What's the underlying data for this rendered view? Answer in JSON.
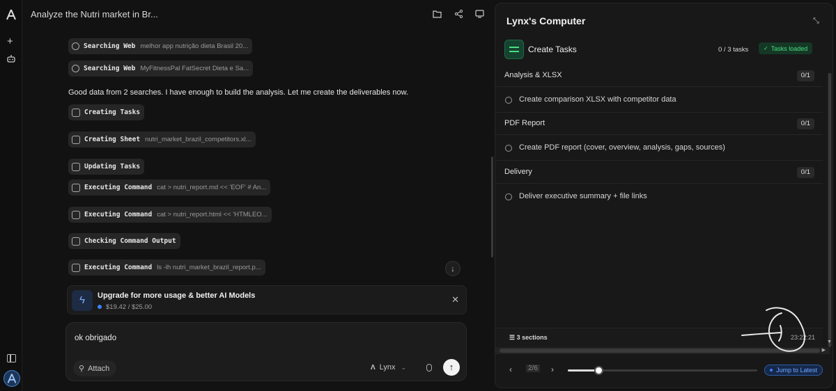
{
  "app": {
    "title": "Analyze the Nutri market in Br..."
  },
  "rail": {
    "icons": [
      "app-logo-icon",
      "plus-icon",
      "bot-icon",
      "sidebar-toggle-icon",
      "avatar"
    ]
  },
  "topbar": {
    "icons": [
      "folder-icon",
      "share-icon",
      "monitor-icon"
    ]
  },
  "chat": {
    "cut_text": "                 ",
    "steps": [
      {
        "icon": "search-icon",
        "action": "Searching Web",
        "detail": "melhor app nutrição dieta Brasil 20..."
      },
      {
        "icon": "search-icon",
        "action": "Searching Web",
        "detail": "MyFitnessPal FatSecret Dieta e Sa..."
      },
      {
        "icon": "list-icon",
        "action": "Creating Tasks",
        "detail": ""
      },
      {
        "icon": "table-icon",
        "action": "Creating Sheet",
        "detail": "nutri_market_brazil_competitors.xl..."
      },
      {
        "icon": "list-icon",
        "action": "Updating Tasks",
        "detail": ""
      },
      {
        "icon": "terminal-icon",
        "action": "Executing Command",
        "detail": "cat > nutri_report.md << 'EOF' # An..."
      },
      {
        "icon": "terminal-icon",
        "action": "Executing Command",
        "detail": "cat > nutri_report.html << 'HTMLEO..."
      },
      {
        "icon": "terminal-icon",
        "action": "Checking Command Output",
        "detail": ""
      },
      {
        "icon": "terminal-icon",
        "action": "Executing Command",
        "detail": "ls -lh nutri_market_brazil_report.p..."
      }
    ],
    "message": "Good data from 2 searches. I have enough to build the analysis. Let me create the deliverables now."
  },
  "upgrade": {
    "title": "Upgrade for more usage & better AI Models",
    "usage": "$19.42 / $25.00"
  },
  "composer": {
    "input_value": "ok obrigado",
    "attach_label": "Attach",
    "model_label": "Lynx"
  },
  "panel": {
    "title": "Lynx's Computer",
    "create_tasks_label": "Create Tasks",
    "task_count": "0 / 3 tasks",
    "loaded_label": "Tasks loaded",
    "sections": [
      {
        "name": "Analysis & XLSX",
        "badge": "0/1",
        "task": "Create comparison XLSX with competitor data"
      },
      {
        "name": "PDF Report",
        "badge": "0/1",
        "task": "Create PDF report (cover, overview, analysis, gaps, sources)"
      },
      {
        "name": "Delivery",
        "badge": "0/1",
        "task": "Deliver executive summary + file links"
      }
    ],
    "footer_sections": "3 sections",
    "footer_time": "23:22:21",
    "page_indicator": "2/6",
    "progress": 0.16,
    "jump_label": "Jump to Latest"
  },
  "colors": {
    "background": "#121212",
    "panel": "#181818",
    "accent_green": "#4ade80",
    "accent_blue": "#3b82f6"
  }
}
